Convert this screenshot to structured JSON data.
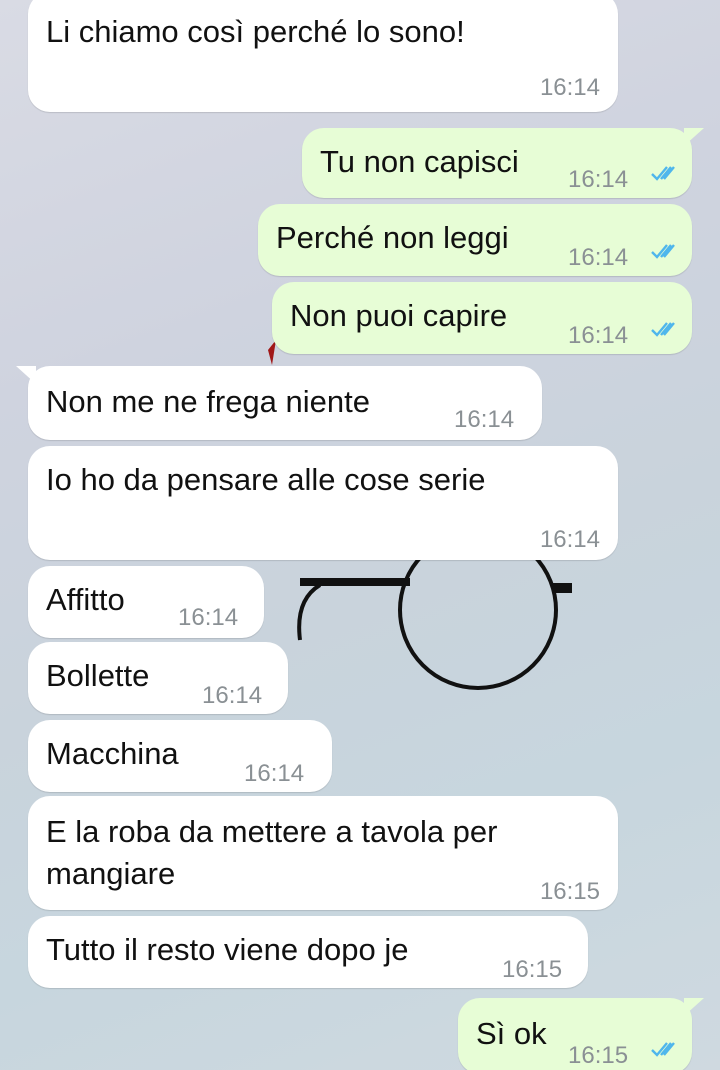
{
  "theme": {
    "incoming_bg": "#ffffff",
    "outgoing_bg": "#e7fdd6",
    "read_ticks_color": "#4fb6ec",
    "time_color": "#8a9094"
  },
  "messages": [
    {
      "direction": "incoming",
      "text": "Li chiamo così perché lo sono!",
      "time": "16:14"
    },
    {
      "direction": "outgoing",
      "text": "Tu non capisci",
      "time": "16:14",
      "status": "read-double-check-icon"
    },
    {
      "direction": "outgoing",
      "text": "Perché non leggi",
      "time": "16:14",
      "status": "read-double-check-icon"
    },
    {
      "direction": "outgoing",
      "text": "Non puoi capire",
      "time": "16:14",
      "status": "read-double-check-icon"
    },
    {
      "direction": "incoming",
      "text": "Non me ne frega niente",
      "time": "16:14"
    },
    {
      "direction": "incoming",
      "text": "Io ho da pensare alle cose serie",
      "time": "16:14"
    },
    {
      "direction": "incoming",
      "text": "Affitto",
      "time": "16:14"
    },
    {
      "direction": "incoming",
      "text": "Bollette",
      "time": "16:14"
    },
    {
      "direction": "incoming",
      "text": "Macchina",
      "time": "16:14"
    },
    {
      "direction": "incoming",
      "text_line1": "E la roba da mettere a tavola per",
      "text_line2": "mangiare",
      "time": "16:15"
    },
    {
      "direction": "incoming",
      "text": "Tutto il resto viene dopo je",
      "time": "16:15"
    },
    {
      "direction": "outgoing",
      "text": "Sì ok",
      "time": "16:15",
      "status": "read-double-check-icon"
    }
  ]
}
